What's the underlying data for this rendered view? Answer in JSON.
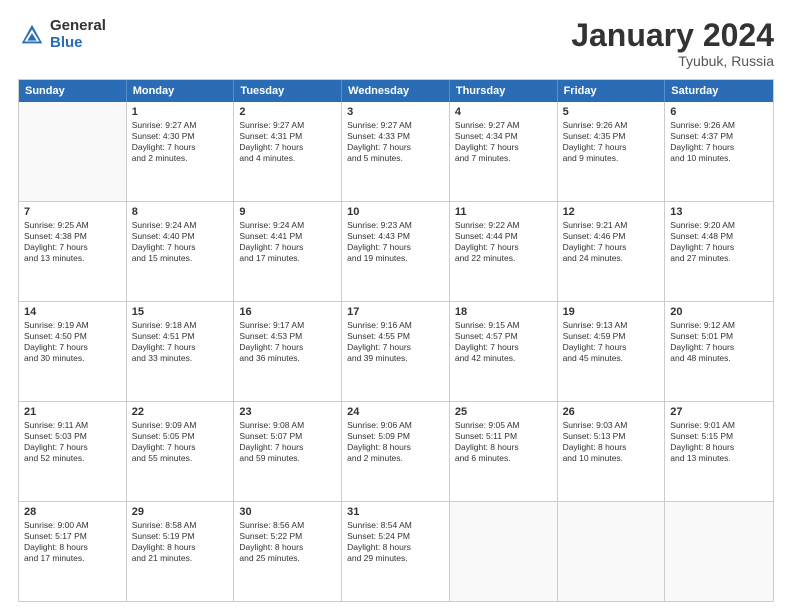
{
  "header": {
    "logo": {
      "general": "General",
      "blue": "Blue"
    },
    "title": "January 2024",
    "location": "Tyubuk, Russia"
  },
  "weekdays": [
    "Sunday",
    "Monday",
    "Tuesday",
    "Wednesday",
    "Thursday",
    "Friday",
    "Saturday"
  ],
  "weeks": [
    [
      {
        "day": "",
        "sunrise": "",
        "sunset": "",
        "daylight": "",
        "empty": true
      },
      {
        "day": "1",
        "sunrise": "Sunrise: 9:27 AM",
        "sunset": "Sunset: 4:30 PM",
        "daylight": "Daylight: 7 hours",
        "daylight2": "and 2 minutes."
      },
      {
        "day": "2",
        "sunrise": "Sunrise: 9:27 AM",
        "sunset": "Sunset: 4:31 PM",
        "daylight": "Daylight: 7 hours",
        "daylight2": "and 4 minutes."
      },
      {
        "day": "3",
        "sunrise": "Sunrise: 9:27 AM",
        "sunset": "Sunset: 4:33 PM",
        "daylight": "Daylight: 7 hours",
        "daylight2": "and 5 minutes."
      },
      {
        "day": "4",
        "sunrise": "Sunrise: 9:27 AM",
        "sunset": "Sunset: 4:34 PM",
        "daylight": "Daylight: 7 hours",
        "daylight2": "and 7 minutes."
      },
      {
        "day": "5",
        "sunrise": "Sunrise: 9:26 AM",
        "sunset": "Sunset: 4:35 PM",
        "daylight": "Daylight: 7 hours",
        "daylight2": "and 9 minutes."
      },
      {
        "day": "6",
        "sunrise": "Sunrise: 9:26 AM",
        "sunset": "Sunset: 4:37 PM",
        "daylight": "Daylight: 7 hours",
        "daylight2": "and 10 minutes."
      }
    ],
    [
      {
        "day": "7",
        "sunrise": "Sunrise: 9:25 AM",
        "sunset": "Sunset: 4:38 PM",
        "daylight": "Daylight: 7 hours",
        "daylight2": "and 13 minutes."
      },
      {
        "day": "8",
        "sunrise": "Sunrise: 9:24 AM",
        "sunset": "Sunset: 4:40 PM",
        "daylight": "Daylight: 7 hours",
        "daylight2": "and 15 minutes."
      },
      {
        "day": "9",
        "sunrise": "Sunrise: 9:24 AM",
        "sunset": "Sunset: 4:41 PM",
        "daylight": "Daylight: 7 hours",
        "daylight2": "and 17 minutes."
      },
      {
        "day": "10",
        "sunrise": "Sunrise: 9:23 AM",
        "sunset": "Sunset: 4:43 PM",
        "daylight": "Daylight: 7 hours",
        "daylight2": "and 19 minutes."
      },
      {
        "day": "11",
        "sunrise": "Sunrise: 9:22 AM",
        "sunset": "Sunset: 4:44 PM",
        "daylight": "Daylight: 7 hours",
        "daylight2": "and 22 minutes."
      },
      {
        "day": "12",
        "sunrise": "Sunrise: 9:21 AM",
        "sunset": "Sunset: 4:46 PM",
        "daylight": "Daylight: 7 hours",
        "daylight2": "and 24 minutes."
      },
      {
        "day": "13",
        "sunrise": "Sunrise: 9:20 AM",
        "sunset": "Sunset: 4:48 PM",
        "daylight": "Daylight: 7 hours",
        "daylight2": "and 27 minutes."
      }
    ],
    [
      {
        "day": "14",
        "sunrise": "Sunrise: 9:19 AM",
        "sunset": "Sunset: 4:50 PM",
        "daylight": "Daylight: 7 hours",
        "daylight2": "and 30 minutes."
      },
      {
        "day": "15",
        "sunrise": "Sunrise: 9:18 AM",
        "sunset": "Sunset: 4:51 PM",
        "daylight": "Daylight: 7 hours",
        "daylight2": "and 33 minutes."
      },
      {
        "day": "16",
        "sunrise": "Sunrise: 9:17 AM",
        "sunset": "Sunset: 4:53 PM",
        "daylight": "Daylight: 7 hours",
        "daylight2": "and 36 minutes."
      },
      {
        "day": "17",
        "sunrise": "Sunrise: 9:16 AM",
        "sunset": "Sunset: 4:55 PM",
        "daylight": "Daylight: 7 hours",
        "daylight2": "and 39 minutes."
      },
      {
        "day": "18",
        "sunrise": "Sunrise: 9:15 AM",
        "sunset": "Sunset: 4:57 PM",
        "daylight": "Daylight: 7 hours",
        "daylight2": "and 42 minutes."
      },
      {
        "day": "19",
        "sunrise": "Sunrise: 9:13 AM",
        "sunset": "Sunset: 4:59 PM",
        "daylight": "Daylight: 7 hours",
        "daylight2": "and 45 minutes."
      },
      {
        "day": "20",
        "sunrise": "Sunrise: 9:12 AM",
        "sunset": "Sunset: 5:01 PM",
        "daylight": "Daylight: 7 hours",
        "daylight2": "and 48 minutes."
      }
    ],
    [
      {
        "day": "21",
        "sunrise": "Sunrise: 9:11 AM",
        "sunset": "Sunset: 5:03 PM",
        "daylight": "Daylight: 7 hours",
        "daylight2": "and 52 minutes."
      },
      {
        "day": "22",
        "sunrise": "Sunrise: 9:09 AM",
        "sunset": "Sunset: 5:05 PM",
        "daylight": "Daylight: 7 hours",
        "daylight2": "and 55 minutes."
      },
      {
        "day": "23",
        "sunrise": "Sunrise: 9:08 AM",
        "sunset": "Sunset: 5:07 PM",
        "daylight": "Daylight: 7 hours",
        "daylight2": "and 59 minutes."
      },
      {
        "day": "24",
        "sunrise": "Sunrise: 9:06 AM",
        "sunset": "Sunset: 5:09 PM",
        "daylight": "Daylight: 8 hours",
        "daylight2": "and 2 minutes."
      },
      {
        "day": "25",
        "sunrise": "Sunrise: 9:05 AM",
        "sunset": "Sunset: 5:11 PM",
        "daylight": "Daylight: 8 hours",
        "daylight2": "and 6 minutes."
      },
      {
        "day": "26",
        "sunrise": "Sunrise: 9:03 AM",
        "sunset": "Sunset: 5:13 PM",
        "daylight": "Daylight: 8 hours",
        "daylight2": "and 10 minutes."
      },
      {
        "day": "27",
        "sunrise": "Sunrise: 9:01 AM",
        "sunset": "Sunset: 5:15 PM",
        "daylight": "Daylight: 8 hours",
        "daylight2": "and 13 minutes."
      }
    ],
    [
      {
        "day": "28",
        "sunrise": "Sunrise: 9:00 AM",
        "sunset": "Sunset: 5:17 PM",
        "daylight": "Daylight: 8 hours",
        "daylight2": "and 17 minutes."
      },
      {
        "day": "29",
        "sunrise": "Sunrise: 8:58 AM",
        "sunset": "Sunset: 5:19 PM",
        "daylight": "Daylight: 8 hours",
        "daylight2": "and 21 minutes."
      },
      {
        "day": "30",
        "sunrise": "Sunrise: 8:56 AM",
        "sunset": "Sunset: 5:22 PM",
        "daylight": "Daylight: 8 hours",
        "daylight2": "and 25 minutes."
      },
      {
        "day": "31",
        "sunrise": "Sunrise: 8:54 AM",
        "sunset": "Sunset: 5:24 PM",
        "daylight": "Daylight: 8 hours",
        "daylight2": "and 29 minutes."
      },
      {
        "day": "",
        "sunrise": "",
        "sunset": "",
        "daylight": "",
        "daylight2": "",
        "empty": true
      },
      {
        "day": "",
        "sunrise": "",
        "sunset": "",
        "daylight": "",
        "daylight2": "",
        "empty": true
      },
      {
        "day": "",
        "sunrise": "",
        "sunset": "",
        "daylight": "",
        "daylight2": "",
        "empty": true
      }
    ]
  ]
}
